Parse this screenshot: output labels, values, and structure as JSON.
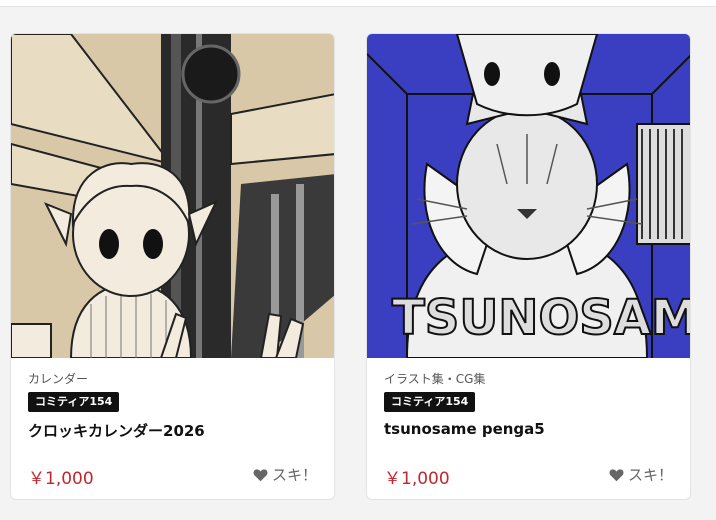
{
  "products": [
    {
      "category": "カレンダー",
      "badge": "コミティア154",
      "title": "クロッキカレンダー2026",
      "price": "￥1,000",
      "like_label": "スキ！",
      "thumbnail_icon": "manga-girl-illustration"
    },
    {
      "category": "イラスト集・CG集",
      "badge": "コミティア154",
      "title": "tsunosame penga5",
      "price": "￥1,000",
      "like_label": "スキ！",
      "thumbnail_icon": "manga-cat-illustration"
    }
  ],
  "colors": {
    "price": "#c0282d",
    "badge_bg": "#111111",
    "thumb1_bg": "#d9c8a8",
    "thumb2_bg": "#3a3fc2"
  }
}
